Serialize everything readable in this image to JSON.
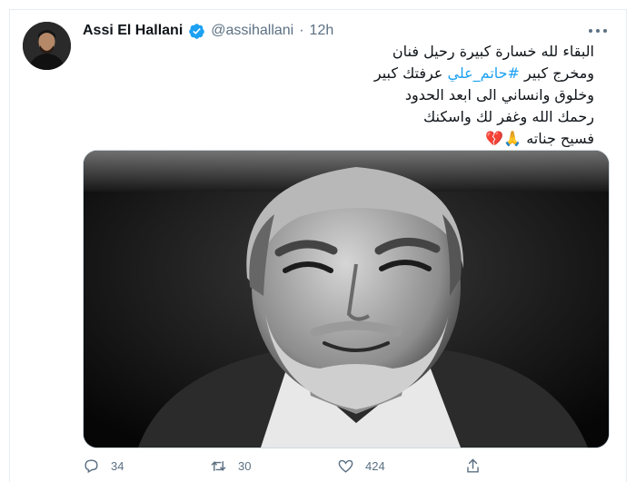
{
  "tweet": {
    "author": {
      "name": "Assi El Hallani",
      "handle": "@assihallani",
      "verified": true
    },
    "separator": "·",
    "time": "12h",
    "text_lines": [
      {
        "before": "البقاء لله خسارة كبيرة رحيل فنان",
        "hashtag": "",
        "after": ""
      },
      {
        "before": "ومخرج كبير ",
        "hashtag": "#حاتم_علي",
        "after": " عرفتك كبير"
      },
      {
        "before": "وخلوق وانساني الى ابعد الحدود",
        "hashtag": "",
        "after": ""
      },
      {
        "before": "رحمك الله وغفر لك واسكنك",
        "hashtag": "",
        "after": ""
      },
      {
        "before": "فسيح جناته 🙏💔",
        "hashtag": "",
        "after": ""
      }
    ],
    "stats": {
      "replies": "34",
      "retweets": "30",
      "likes": "424"
    }
  },
  "colors": {
    "accent": "#1da1f2",
    "muted": "#5b7083",
    "text": "#0f1419"
  },
  "icons": {
    "more": "more-icon",
    "verified": "verified-badge-icon",
    "reply": "reply-icon",
    "retweet": "retweet-icon",
    "like": "heart-icon",
    "share": "share-icon"
  }
}
